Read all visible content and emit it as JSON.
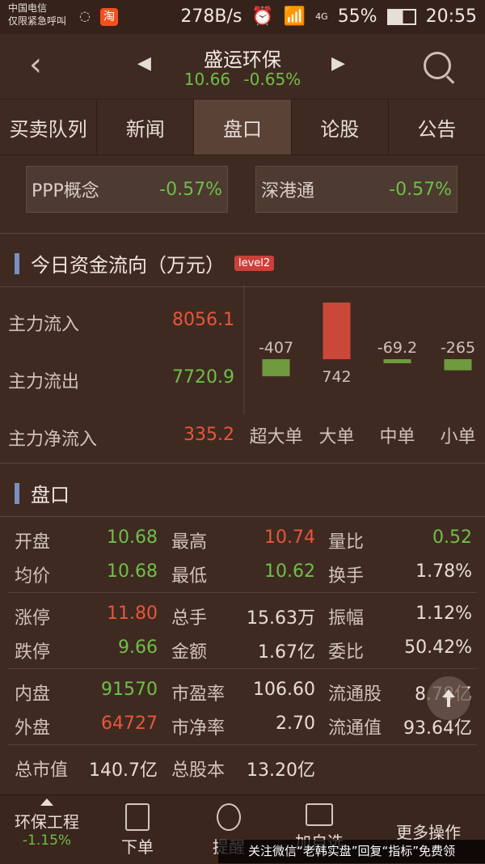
{
  "status": {
    "carrier_line1": "中国电信",
    "carrier_line2": "仅限紧急呼叫",
    "taobao": "淘",
    "speed": "278B/s",
    "net": "4G",
    "battery": "55%",
    "time": "20:55"
  },
  "header": {
    "title": "盛运环保",
    "price": "10.66",
    "change": "-0.65%"
  },
  "tabs": [
    "买卖队列",
    "新闻",
    "盘口",
    "论股",
    "公告"
  ],
  "active_tab": 2,
  "concepts": [
    {
      "name": "PPP概念",
      "pct": "-0.57%"
    },
    {
      "name": "深港通",
      "pct": "-0.57%"
    }
  ],
  "fund_flow": {
    "title": "今日资金流向（万元）",
    "badge": "level2",
    "rows": [
      {
        "label": "主力流入",
        "value": "8056.1"
      },
      {
        "label": "主力流出",
        "value": "7720.9"
      },
      {
        "label": "主力净流入",
        "value": "335.2"
      }
    ]
  },
  "chart_data": {
    "type": "bar",
    "categories": [
      "超大单",
      "大单",
      "中单",
      "小单"
    ],
    "values": [
      -407,
      742,
      -69.2,
      -265
    ],
    "value_labels": [
      "-407",
      "742",
      "-69.2",
      "-265"
    ],
    "colors": {
      "positive": "#c9483a",
      "negative": "#6f9a3e"
    }
  },
  "pankou": {
    "title": "盘口",
    "rows": [
      [
        {
          "l": "开盘",
          "v": "10.68",
          "c": "green"
        },
        {
          "l": "最高",
          "v": "10.74",
          "c": "red"
        },
        {
          "l": "量比",
          "v": "0.52",
          "c": "green"
        }
      ],
      [
        {
          "l": "均价",
          "v": "10.68",
          "c": "green"
        },
        {
          "l": "最低",
          "v": "10.62",
          "c": "green"
        },
        {
          "l": "换手",
          "v": "1.78%",
          "c": "white"
        }
      ],
      [
        {
          "l": "涨停",
          "v": "11.80",
          "c": "red"
        },
        {
          "l": "总手",
          "v": "15.63万",
          "c": "white"
        },
        {
          "l": "振幅",
          "v": "1.12%",
          "c": "white"
        }
      ],
      [
        {
          "l": "跌停",
          "v": "9.66",
          "c": "green"
        },
        {
          "l": "金额",
          "v": "1.67亿",
          "c": "white"
        },
        {
          "l": "委比",
          "v": "50.42%",
          "c": "white"
        }
      ],
      [
        {
          "l": "内盘",
          "v": "91570",
          "c": "green"
        },
        {
          "l": "市盈率",
          "v": "106.60",
          "c": "white"
        },
        {
          "l": "流通股",
          "v": "8.78亿",
          "c": "white"
        }
      ],
      [
        {
          "l": "外盘",
          "v": "64727",
          "c": "red"
        },
        {
          "l": "市净率",
          "v": "2.70",
          "c": "white"
        },
        {
          "l": "流通值",
          "v": "93.64亿",
          "c": "white"
        }
      ],
      [
        {
          "l": "总市值",
          "v": "140.7亿",
          "c": "white"
        },
        {
          "l": "总股本",
          "v": "13.20亿",
          "c": "white"
        }
      ]
    ]
  },
  "bottom": {
    "sector": "环保工程",
    "sector_pct": "-1.15%",
    "order": "下单",
    "warn": "提醒",
    "add": "加自选",
    "more": "更多操作"
  },
  "watermark": "关注微信“老韩实盘”回复“指标”免费领"
}
